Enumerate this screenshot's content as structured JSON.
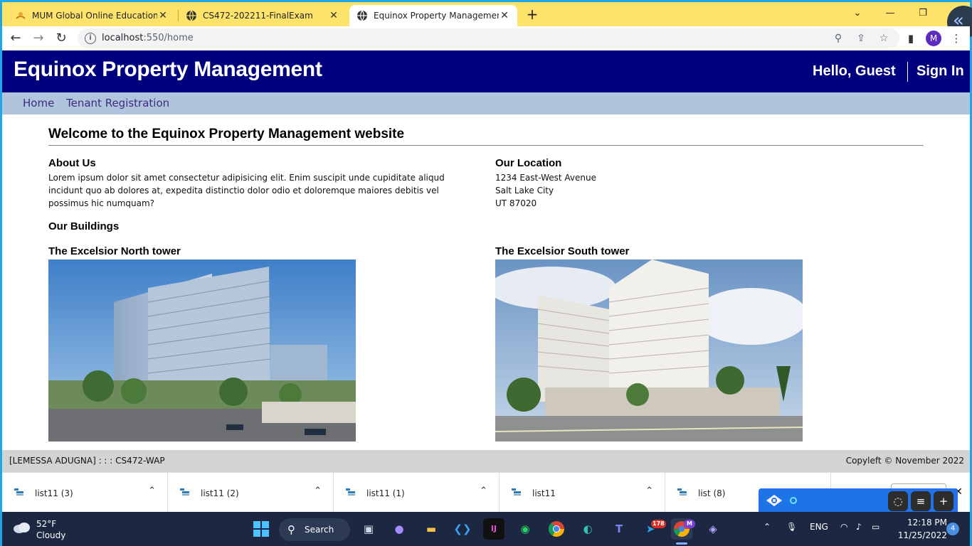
{
  "browser": {
    "tabs": [
      {
        "title": "MUM Global Online Education : C"
      },
      {
        "title": "CS472-202211-FinalExam"
      },
      {
        "title": "Equinox Property Management -"
      }
    ],
    "url_host": "localhost",
    "url_rest": ":550/home",
    "profile_initial": "M"
  },
  "site": {
    "brand": "Equinox Property Management",
    "greeting": "Hello, Guest",
    "signin": "Sign In",
    "nav": [
      "Home",
      "Tenant Registration"
    ],
    "welcome": "Welcome to the Equinox Property Management website",
    "about": {
      "heading": "About Us",
      "text": "Lorem ipsum dolor sit amet consectetur adipisicing elit. Enim suscipit unde cupiditate aliqud incidunt quo ab dolores at, expedita distinctio dolor odio et doloremque maiores debitis vel possimus hic numquam?"
    },
    "location": {
      "heading": "Our Location",
      "lines": [
        "1234 East-West Avenue",
        "Salt Lake City",
        "UT 87020"
      ]
    },
    "buildings_heading": "Our Buildings",
    "buildings": [
      {
        "name": "The Excelsior North tower"
      },
      {
        "name": "The Excelsior South tower"
      }
    ],
    "footer_left": "[LEMESSA ADUGNA] : : : CS472-WAP",
    "footer_right": "Copyleft © November 2022"
  },
  "downloads": [
    {
      "name": "list11 (3)"
    },
    {
      "name": "list11 (2)"
    },
    {
      "name": "list11 (1)"
    },
    {
      "name": "list11"
    },
    {
      "name": "list (8)"
    }
  ],
  "taskbar": {
    "weather_temp": "52°F",
    "weather_desc": "Cloudy",
    "search_label": "Search",
    "telegram_badge": "178",
    "chrome_profile": "M",
    "lang": "ENG",
    "time": "12:18 PM",
    "date": "11/25/2022",
    "notifications": "4"
  }
}
